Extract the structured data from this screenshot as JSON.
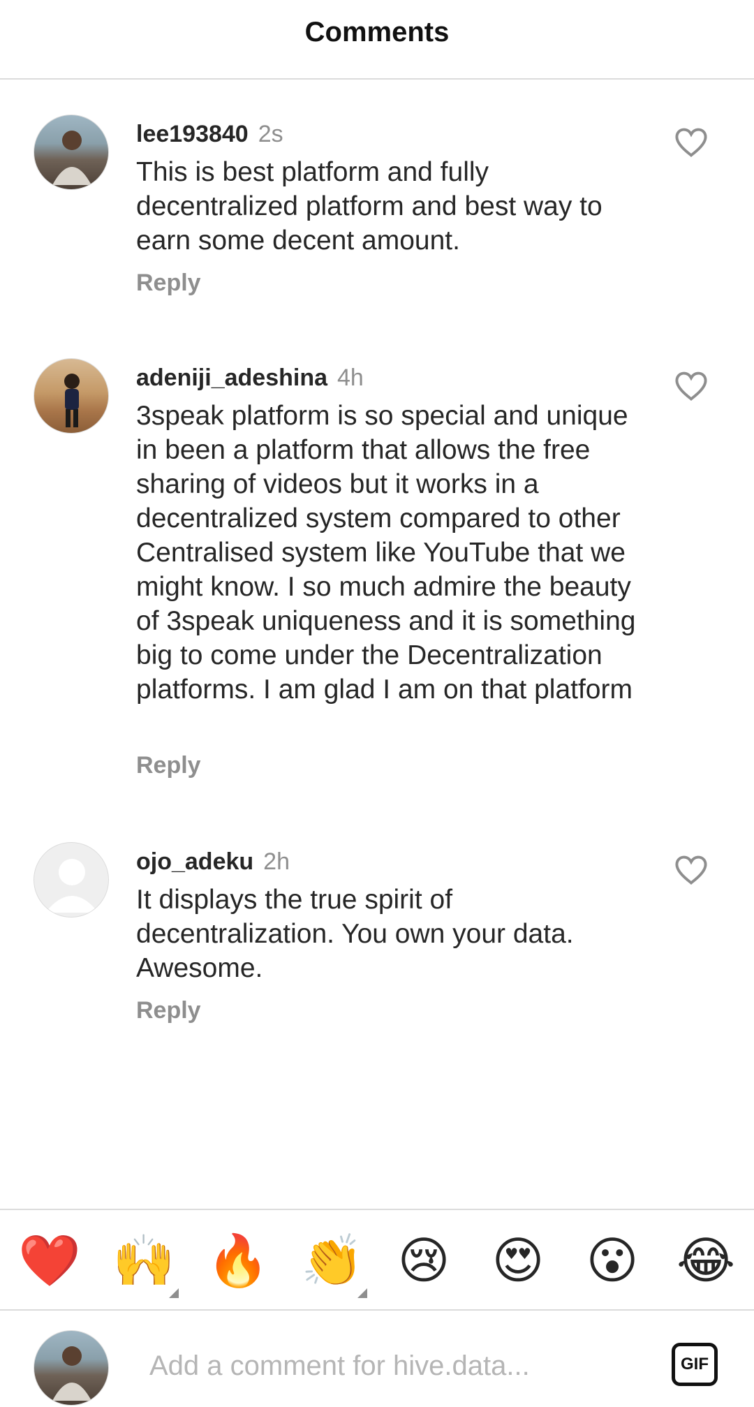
{
  "header": {
    "title": "Comments"
  },
  "comments": [
    {
      "username": "lee193840",
      "time": "2s",
      "text": "This is best platform and fully decentralized platform and best way to earn some decent amount.",
      "reply_label": "Reply",
      "avatar": "user-photo"
    },
    {
      "username": "adeniji_adeshina",
      "time": "4h",
      "text": "3speak platform is so special and unique in been a platform that allows the free sharing of videos but it works in a decentralized system compared to other Centralised system like YouTube that we might know. I so much admire the beauty of 3speak uniqueness and it is something big to come under the Decentralization platforms. I am glad I am on that platform",
      "reply_label": "Reply",
      "avatar": "user-photo"
    },
    {
      "username": "ojo_adeku",
      "time": "2h",
      "text": "It displays the true spirit of decentralization. You own your data. Awesome.",
      "reply_label": "Reply",
      "avatar": "default-avatar"
    }
  ],
  "emoji_bar": {
    "emojis": [
      "❤️",
      "🙌",
      "🔥",
      "👏",
      "😢",
      "😍",
      "😮",
      "😂"
    ]
  },
  "composer": {
    "placeholder": "Add a comment for hive.data...",
    "gif_label": "GIF"
  },
  "colors": {
    "text": "#262626",
    "secondary": "#8e8e8e",
    "divider": "#dbdbdb",
    "placeholder": "#b5b5b5"
  }
}
